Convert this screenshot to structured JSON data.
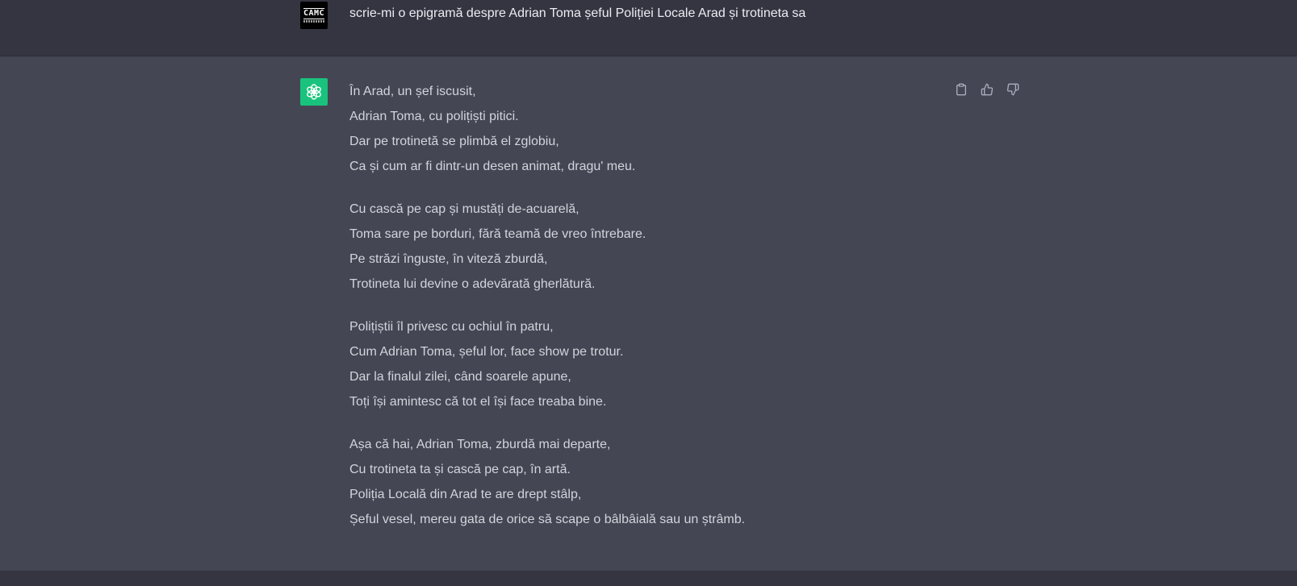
{
  "user_message": {
    "avatar_logo_text": "CAMC",
    "text": "scrie-mi o epigramă despre Adrian Toma șeful Poliției Locale Arad și trotineta sa"
  },
  "assistant_message": {
    "stanzas": [
      {
        "lines": [
          "În Arad, un șef iscusit,",
          "Adrian Toma, cu polițiști pitici.",
          "Dar pe trotinetă se plimbă el zglobiu,",
          "Ca și cum ar fi dintr-un desen animat, dragu' meu."
        ]
      },
      {
        "lines": [
          "Cu cască pe cap și mustăți de-acuarelă,",
          "Toma sare pe borduri, fără teamă de vreo întrebare.",
          "Pe străzi înguste, în viteză zburdă,",
          "Trotineta lui devine o adevărată gherlătură."
        ]
      },
      {
        "lines": [
          "Polițiștii îl privesc cu ochiul în patru,",
          "Cum Adrian Toma, șeful lor, face show pe trotur.",
          "Dar la finalul zilei, când soarele apune,",
          "Toți își amintesc că tot el își face treaba bine."
        ]
      },
      {
        "lines": [
          "Așa că hai, Adrian Toma, zburdă mai departe,",
          "Cu trotineta ta și cască pe cap, în artă.",
          "Poliția Locală din Arad te are drept stâlp,",
          "Șeful vesel, mereu gata de orice să scape o bâlbâială sau un ștrâmb."
        ]
      }
    ],
    "actions": [
      "clipboard-icon",
      "thumbs-up-icon",
      "thumbs-down-icon"
    ]
  },
  "colors": {
    "user_bg": "#343541",
    "assistant_bg": "#444654",
    "gpt_avatar": "#19c37d"
  }
}
